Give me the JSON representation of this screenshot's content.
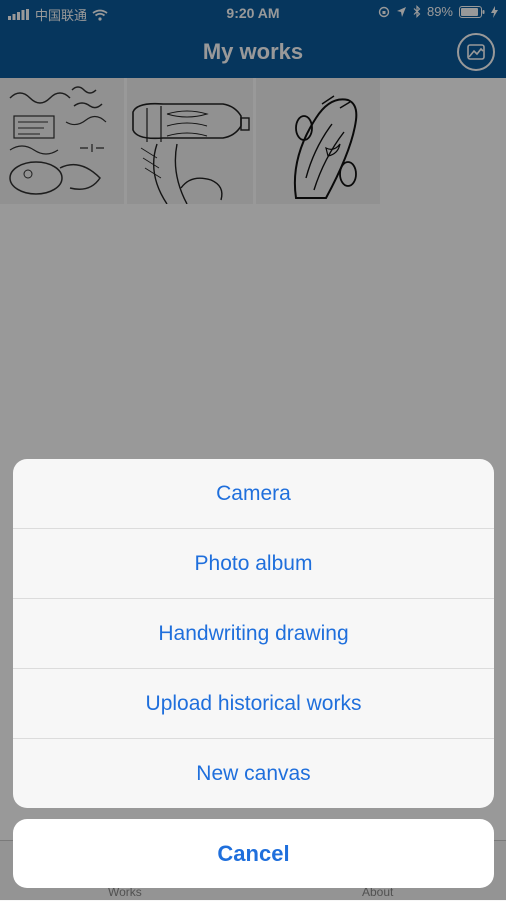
{
  "status_bar": {
    "carrier": "中国联通",
    "time": "9:20 AM",
    "battery": "89%"
  },
  "nav": {
    "title": "My works",
    "action_icon": "gallery-icon"
  },
  "works": [
    {
      "name": "doodle-sketch"
    },
    {
      "name": "bottle-sketch"
    },
    {
      "name": "car-sketch"
    }
  ],
  "tab_bar": {
    "tabs": [
      {
        "label": "Works"
      },
      {
        "label": "About"
      }
    ]
  },
  "action_sheet": {
    "items": [
      {
        "label": "Camera"
      },
      {
        "label": "Photo album"
      },
      {
        "label": "Handwriting drawing"
      },
      {
        "label": "Upload historical works"
      },
      {
        "label": "New canvas"
      }
    ],
    "cancel_label": "Cancel"
  },
  "colors": {
    "nav_background": "#0a5a9c",
    "action_text": "#1f6fdc",
    "overlay": "rgba(0,0,0,0.40)"
  }
}
